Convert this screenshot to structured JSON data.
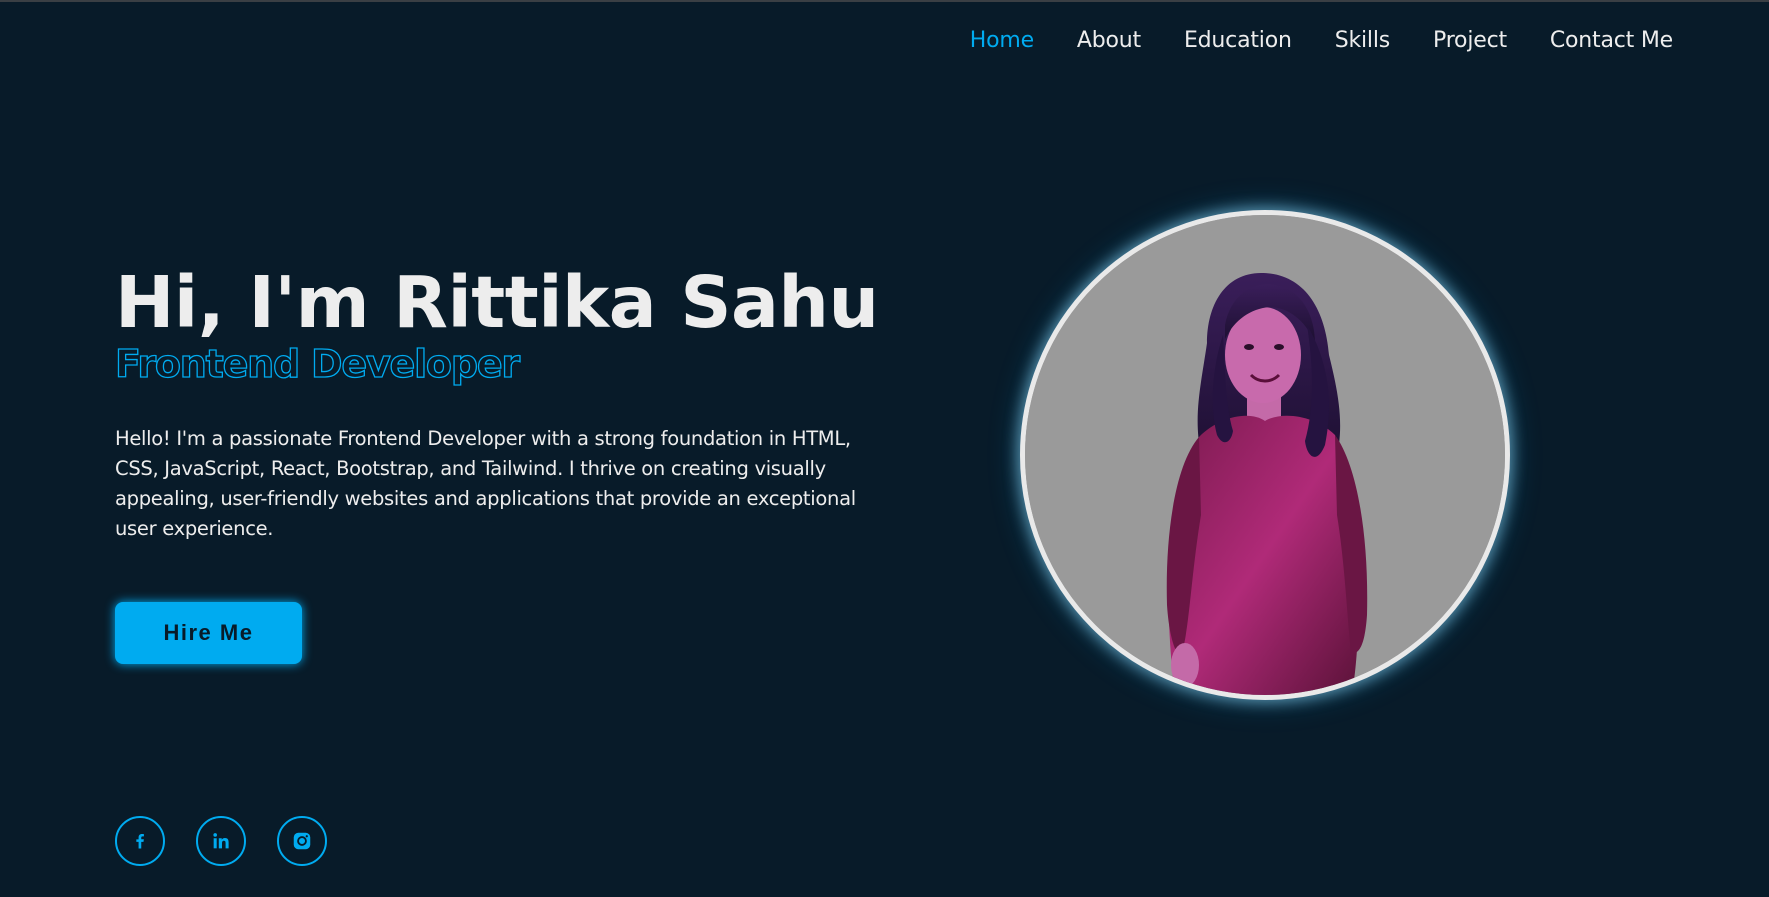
{
  "nav": {
    "items": [
      {
        "label": "Home",
        "active": true
      },
      {
        "label": "About",
        "active": false
      },
      {
        "label": "Education",
        "active": false
      },
      {
        "label": "Skills",
        "active": false
      },
      {
        "label": "Project",
        "active": false
      },
      {
        "label": "Contact Me",
        "active": false
      }
    ]
  },
  "hero": {
    "heading": "Hi, I'm Rittika Sahu",
    "role": "Frontend Developer",
    "description": "Hello! I'm a passionate Frontend Developer with a strong foundation in HTML, CSS, JavaScript, React, Bootstrap, and Tailwind. I thrive on creating visually appealing, user-friendly websites and applications that provide an exceptional user experience.",
    "cta_label": "Hire Me"
  },
  "socials": [
    {
      "icon": "facebook-icon"
    },
    {
      "icon": "linkedin-icon"
    },
    {
      "icon": "instagram-icon"
    }
  ],
  "colors": {
    "background": "#081b29",
    "accent": "#00abf0",
    "text": "#ededed",
    "photo_background": "#9a9a9a"
  }
}
